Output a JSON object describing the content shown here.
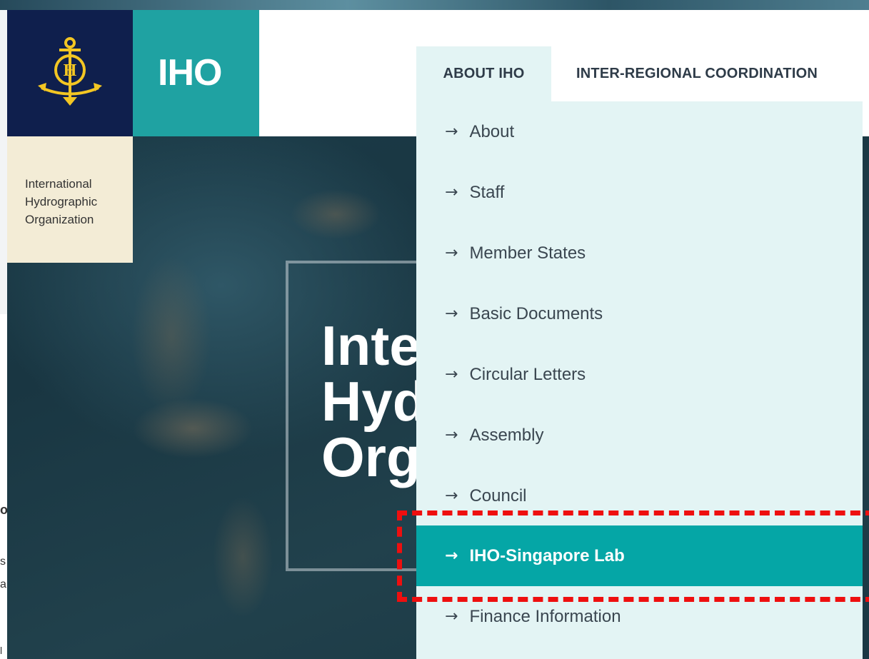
{
  "header": {
    "logo_icon": "anchor-emblem-icon",
    "short_name": "IHO",
    "org_name_lines": [
      "International",
      "Hydrographic",
      "Organization"
    ]
  },
  "nav": {
    "tabs": [
      {
        "label": "ABOUT IHO",
        "active": true
      },
      {
        "label": "INTER-REGIONAL COORDINATION",
        "active": false
      }
    ]
  },
  "dropdown": {
    "arrow_glyph": "→",
    "items": [
      {
        "label": "About"
      },
      {
        "label": "Staff"
      },
      {
        "label": "Member States"
      },
      {
        "label": "Basic Documents"
      },
      {
        "label": "Circular Letters"
      },
      {
        "label": "Assembly"
      },
      {
        "label": "Council"
      },
      {
        "label": "IHO-Singapore Lab",
        "highlighted": true
      },
      {
        "label": "Finance Information"
      }
    ]
  },
  "hero": {
    "title_lines": [
      "Inte",
      "Hyd",
      "Org"
    ]
  },
  "background_page": {
    "cut_chars": [
      "o",
      "s",
      "a",
      "l"
    ]
  },
  "colors": {
    "navy": "#0f1f4d",
    "teal": "#1fa2a2",
    "dropdown_bg": "#e3f4f4",
    "active_item": "#05a6a6",
    "cream": "#f3ecd6",
    "highlight": "#ee0f0f"
  }
}
